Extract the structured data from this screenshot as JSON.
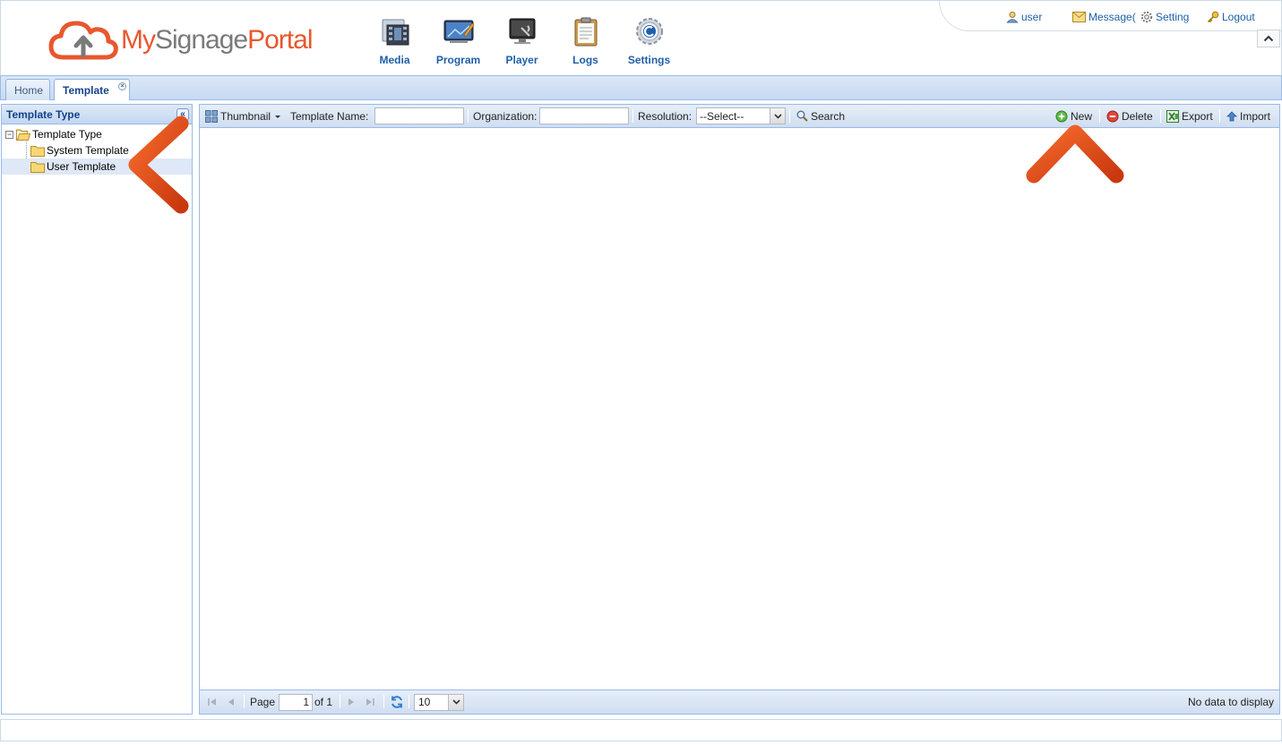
{
  "brand": {
    "logo_part1": "My",
    "logo_part2": "Signage",
    "logo_part3": "Portal"
  },
  "nav": [
    {
      "label": "Media",
      "icon": "media-icon"
    },
    {
      "label": "Program",
      "icon": "program-icon"
    },
    {
      "label": "Player",
      "icon": "player-icon"
    },
    {
      "label": "Logs",
      "icon": "logs-icon"
    },
    {
      "label": "Settings",
      "icon": "settings-icon"
    }
  ],
  "user_menu": {
    "user": "user",
    "message": "Message(",
    "setting": "Setting",
    "logout": "Logout"
  },
  "tabs": [
    {
      "label": "Home"
    },
    {
      "label": "Template"
    }
  ],
  "west": {
    "title": "Template Type",
    "tree": {
      "root": "Template Type",
      "children": [
        "System Template",
        "User Template"
      ]
    }
  },
  "toolbar": {
    "view_mode": "Thumbnail",
    "template_name_label": "Template Name:",
    "template_name_value": "",
    "organization_label": "Organization:",
    "organization_value": "",
    "resolution_label": "Resolution:",
    "resolution_value": "--Select--",
    "search": "Search",
    "new": "New",
    "delete": "Delete",
    "export": "Export",
    "import": "Import"
  },
  "pager": {
    "page_label": "Page",
    "page_value": "1",
    "of_label": "of 1",
    "page_size": "10",
    "status": "No data to display"
  },
  "colors": {
    "brand_orange": "#e8572d",
    "nav_blue": "#1f5fa8",
    "panel_border": "#99bbe8",
    "annotation_arrow": "#e0441c"
  }
}
